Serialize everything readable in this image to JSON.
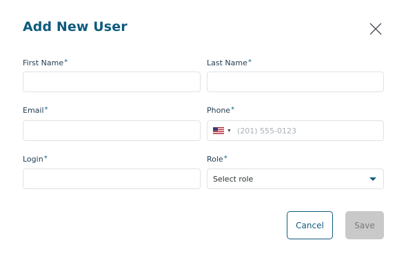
{
  "dialog": {
    "title": "Add New User",
    "close_icon": "close-icon"
  },
  "fields": {
    "first_name": {
      "label": "First Name",
      "required": "*",
      "value": ""
    },
    "last_name": {
      "label": "Last Name",
      "required": "*",
      "value": ""
    },
    "email": {
      "label": "Email",
      "required": "*",
      "value": ""
    },
    "phone": {
      "label": "Phone",
      "required": "*",
      "placeholder": "(201) 555-0123",
      "country_icon": "us-flag-icon"
    },
    "login": {
      "label": "Login",
      "required": "*",
      "value": ""
    },
    "role": {
      "label": "Role",
      "required": "*",
      "selected": "Select role"
    }
  },
  "actions": {
    "cancel_label": "Cancel",
    "save_label": "Save"
  },
  "colors": {
    "accent": "#0d5a7d",
    "disabled_bg": "#c9c9c9",
    "border": "#dde3e8"
  }
}
